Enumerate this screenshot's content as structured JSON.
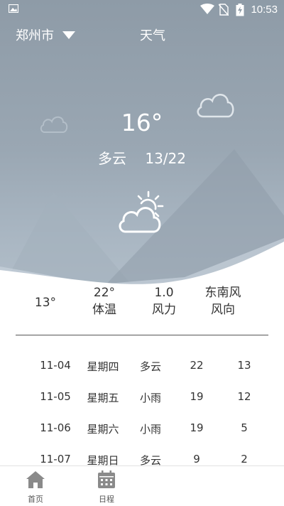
{
  "status_bar": {
    "time": "10:53",
    "icons": [
      "image-icon",
      "wifi-icon",
      "no-sim-icon",
      "battery-charging-icon"
    ]
  },
  "header": {
    "city": "郑州市",
    "title": "天气"
  },
  "current": {
    "temperature": "16°",
    "condition": "多云",
    "range": "13/22",
    "icon": "partly-cloudy-icon"
  },
  "stats": [
    {
      "value": "13°",
      "label": ""
    },
    {
      "value": "22°",
      "label": "体温"
    },
    {
      "value": "1.0",
      "label": "风力"
    },
    {
      "value": "东南风",
      "label": "风向"
    }
  ],
  "forecast": [
    {
      "date": "11-04",
      "weekday": "星期四",
      "condition": "多云",
      "high": "22",
      "low": "13"
    },
    {
      "date": "11-05",
      "weekday": "星期五",
      "condition": "小雨",
      "high": "19",
      "low": "12"
    },
    {
      "date": "11-06",
      "weekday": "星期六",
      "condition": "小雨",
      "high": "19",
      "low": "5"
    },
    {
      "date": "11-07",
      "weekday": "星期日",
      "condition": "多云",
      "high": "9",
      "low": "2"
    }
  ],
  "bottom_nav": [
    {
      "label": "首页",
      "icon": "home-icon"
    },
    {
      "label": "日程",
      "icon": "calendar-icon"
    }
  ],
  "colors": {
    "sky_top": "#8e9ba7",
    "sky_bottom": "#b8c4ce",
    "text_dark": "#333333",
    "icon_gray": "#8a8a8a"
  }
}
